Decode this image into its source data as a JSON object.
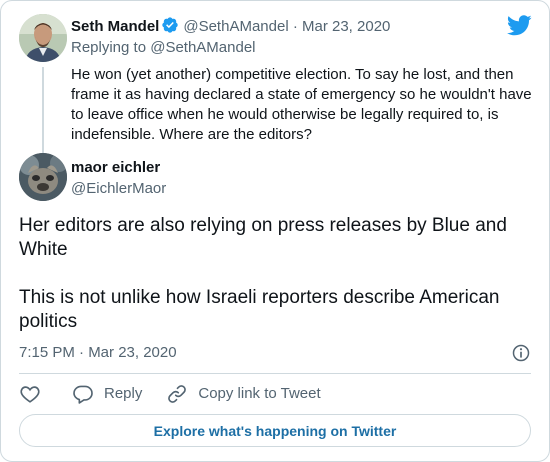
{
  "parent_tweet": {
    "name": "Seth Mandel",
    "handle": "@SethAMandel",
    "separator": "·",
    "date": "Mar 23, 2020",
    "replying_to": "Replying to @SethAMandel",
    "text": "He won (yet another) competitive election. To say he lost, and then frame it as having declared a state of emergency so he wouldn't have to leave office when he would otherwise be legally required to, is indefensible. Where are the editors?"
  },
  "main_tweet": {
    "name": "maor eichler",
    "handle": "@EichlerMaor",
    "paragraphs": [
      "Her editors are also relying on press releases by Blue and White",
      "This is not unlike how Israeli reporters describe American politics"
    ],
    "timestamp": "7:15 PM · Mar 23, 2020"
  },
  "actions": {
    "reply_label": "Reply",
    "copy_link_label": "Copy link to Tweet"
  },
  "explore_label": "Explore what's happening on Twitter",
  "icons": {
    "brand": "twitter-bird-icon",
    "verified": "verified-badge-icon",
    "info": "info-icon",
    "like": "heart-icon",
    "reply": "speech-bubble-icon",
    "copy": "link-icon"
  },
  "colors": {
    "brand_blue": "#1d9bf0",
    "link_blue": "#1d6fa5",
    "text_primary": "#0f1419",
    "text_secondary": "#536471",
    "border": "#cfd9de"
  }
}
